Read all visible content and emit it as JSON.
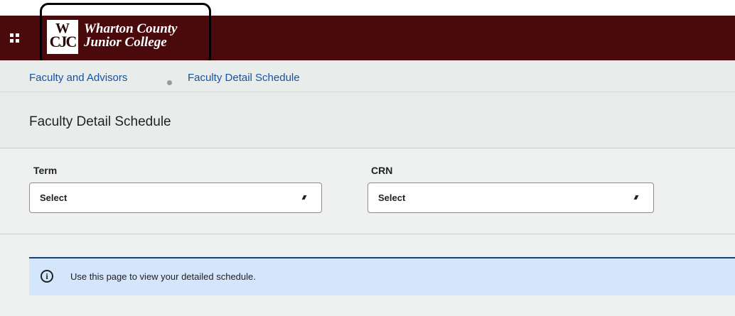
{
  "header": {
    "logo_mark_top": "W",
    "logo_mark_bottom": "CJC",
    "logo_line1": "Wharton County",
    "logo_line2": "Junior College",
    "menu_icon": "grid-menu-icon"
  },
  "breadcrumb": {
    "items": [
      {
        "label": "Faculty and Advisors"
      },
      {
        "label": "Faculty Detail Schedule"
      }
    ]
  },
  "page": {
    "title": "Faculty Detail Schedule"
  },
  "filters": {
    "term_label": "Term",
    "term_value": "Select",
    "crn_label": "CRN",
    "crn_value": "Select"
  },
  "info": {
    "icon": "info-icon",
    "icon_glyph": "i",
    "message": "Use this page to view your detailed schedule."
  },
  "colors": {
    "brand_maroon": "#4a0a0c",
    "link_blue": "#1553a3",
    "info_background": "#d4e6fb",
    "info_border": "#1a3f7a"
  }
}
